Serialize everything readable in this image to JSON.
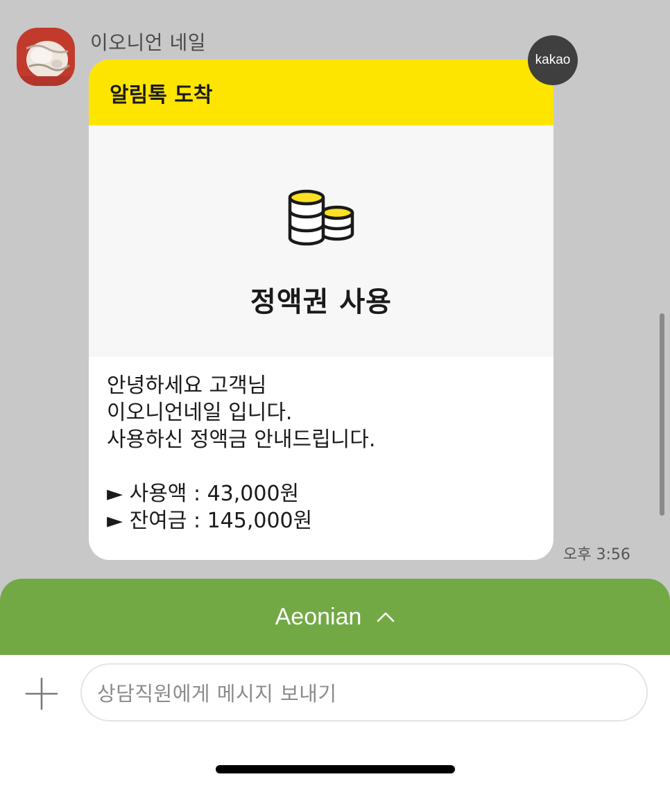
{
  "chat": {
    "sender_name": "이오니언 네일",
    "avatar_icon": "profile-photo",
    "badge_text": "kakao",
    "card": {
      "header_title": "알림톡 도착",
      "hero_icon": "coins-icon",
      "hero_title": "정액권 사용",
      "body_lines": [
        "안녕하세요 고객님",
        "이오니언네일 입니다.",
        "사용하신 정액금 안내드립니다.",
        "",
        "► 사용액 : 43,000원",
        "► 잔여금 : 145,000원"
      ]
    },
    "timestamp": "오후 3:56"
  },
  "menu": {
    "label": "Aeonian",
    "icon": "chevron-up-icon"
  },
  "composer": {
    "placeholder": "상담직원에게 메시지 보내기",
    "plus_icon": "plus-icon"
  },
  "colors": {
    "background": "#c8c8c8",
    "kakao_yellow": "#fee500",
    "menu_green": "#72a945",
    "coin_yellow": "#fbe023"
  }
}
